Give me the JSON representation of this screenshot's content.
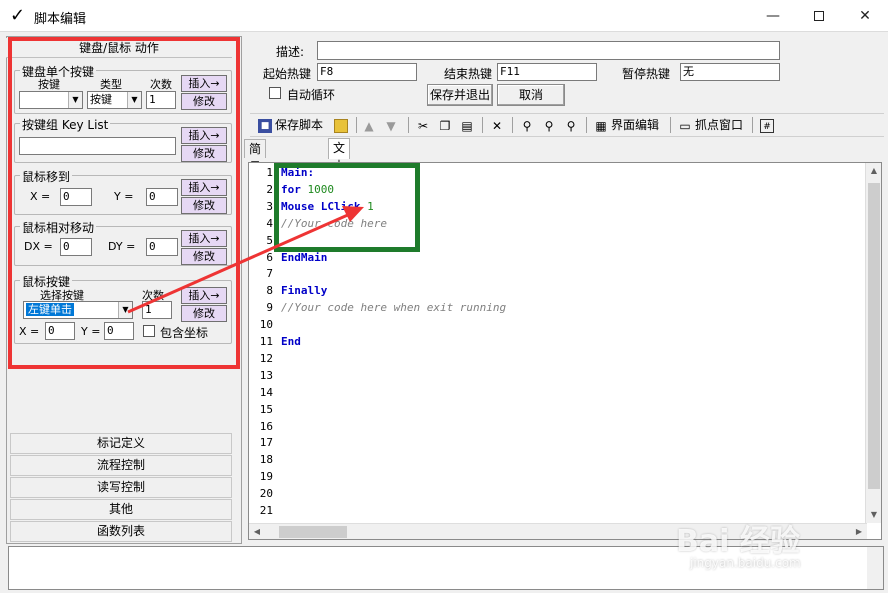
{
  "window": {
    "title": "脚本编辑",
    "minimize": "—",
    "close": "✕"
  },
  "left_panel": {
    "header": "键盘/鼠标 动作",
    "kb_single": {
      "title": "键盘单个按键",
      "key_label": "按键",
      "type_label": "类型",
      "count_label": "次数",
      "key_value": "",
      "type_value": "按键",
      "count_value": "1",
      "insert": "插入→",
      "modify": "修改"
    },
    "key_group": {
      "title": "按键组 Key List",
      "value": "",
      "insert": "插入→",
      "modify": "修改"
    },
    "mouse_move": {
      "title": "鼠标移到",
      "x_label": "X =",
      "y_label": "Y =",
      "x_value": "0",
      "y_value": "0",
      "insert": "插入→",
      "modify": "修改"
    },
    "mouse_rel": {
      "title": "鼠标相对移动",
      "dx_label": "DX =",
      "dy_label": "DY =",
      "dx_value": "0",
      "dy_value": "0",
      "insert": "插入→",
      "modify": "修改"
    },
    "mouse_btn": {
      "title": "鼠标按键",
      "select_label": "选择按键",
      "count_label": "次数",
      "select_value": "左键单击",
      "count_value": "1",
      "x_label": "X =",
      "y_label": "Y =",
      "x_value": "0",
      "y_value": "0",
      "include_coords": "包含坐标",
      "insert": "插入→",
      "modify": "修改"
    },
    "categories": [
      "标记定义",
      "流程控制",
      "读写控制",
      "其他",
      "函数列表"
    ]
  },
  "script_props": {
    "desc_label": "描述:",
    "desc_value": "",
    "start_hotkey_label": "起始热键",
    "start_hotkey_value": "F8",
    "end_hotkey_label": "结束热键",
    "end_hotkey_value": "F11",
    "pause_hotkey_label": "暂停热键",
    "pause_hotkey_value": "无",
    "auto_loop_label": "自动循环",
    "save_exit": "保存并退出",
    "cancel": "取消"
  },
  "toolbar": {
    "save_script": "保存脚本",
    "ui_edit": "界面编辑",
    "capture_window": "抓点窗口"
  },
  "tabs": [
    "简易编辑模式",
    "文本编辑模式"
  ],
  "editor": {
    "line_numbers": [
      "1",
      "2",
      "3",
      "4",
      "5",
      "6",
      "7",
      "8",
      "9",
      "10",
      "11",
      "12",
      "13",
      "14",
      "15",
      "16",
      "17",
      "18",
      "19",
      "20",
      "21"
    ],
    "lines": [
      {
        "kw": "Main:",
        "rest": "",
        "num": "",
        "cm": ""
      },
      {
        "kw": "for",
        "rest": " ",
        "num": "1000",
        "cm": ""
      },
      {
        "kw": "Mouse LClick",
        "rest": " ",
        "num": "1",
        "cm": ""
      },
      {
        "kw": "",
        "rest": "",
        "num": "",
        "cm": "//Your code here"
      },
      {
        "kw": "",
        "rest": "",
        "num": "",
        "cm": ""
      },
      {
        "kw": "EndMain",
        "rest": "",
        "num": "",
        "cm": ""
      },
      {
        "kw": "",
        "rest": "",
        "num": "",
        "cm": ""
      },
      {
        "kw": "Finally",
        "rest": "",
        "num": "",
        "cm": ""
      },
      {
        "kw": "",
        "rest": "",
        "num": "",
        "cm": "//Your code here when exit running"
      },
      {
        "kw": "",
        "rest": "",
        "num": "",
        "cm": ""
      },
      {
        "kw": "End",
        "rest": "",
        "num": "",
        "cm": ""
      }
    ]
  },
  "watermark": {
    "brand": "Bai 经验",
    "url": "jingyan.baidu.com"
  },
  "colors": {
    "red_box": "#ee3434",
    "green_box": "#1e7b2b",
    "arrow": "#ee3434",
    "keyword": "#0000c8",
    "number": "#1f8a1f",
    "comment": "#808080",
    "button_fill": "#e6d8f4"
  }
}
